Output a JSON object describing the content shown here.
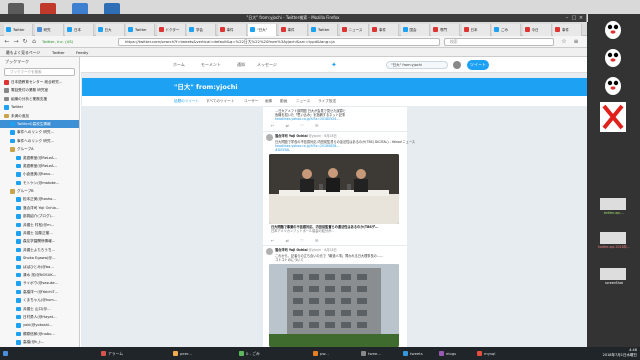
{
  "browser": {
    "window_title": "\"日大\" from:yjochi - Twitter検索 - Mozilla Firefox",
    "url": "https://twitter.com/search?f=tweets&vertical=default&q=%22日大%22%20from%3Ayjochi&src=typd&lang=ja",
    "url_site_label": "Twitter, Inc. (US)",
    "search_placeholder": "検索",
    "tabs": [
      {
        "label": "Twitter",
        "fav_color": "#1da1f2"
      },
      {
        "label": "研究",
        "fav_color": "#4a90d9"
      },
      {
        "label": "日本",
        "fav_color": "#1da1f2"
      },
      {
        "label": "日大",
        "fav_color": "#1da1f2"
      },
      {
        "label": "Twitter",
        "fav_color": "#1da1f2"
      },
      {
        "label": "ドクター",
        "fav_color": "#d33"
      },
      {
        "label": "学会",
        "fav_color": "#1da1f2"
      },
      {
        "label": "事件",
        "fav_color": "#d33"
      },
      {
        "label": "\"日大\"",
        "fav_color": "#1da1f2"
      },
      {
        "label": "事件",
        "fav_color": "#d33"
      },
      {
        "label": "Twitter",
        "fav_color": "#1da1f2"
      },
      {
        "label": "ニュース",
        "fav_color": "#d33"
      },
      {
        "label": "事件",
        "fav_color": "#d33"
      },
      {
        "label": "国会",
        "fav_color": "#1da1f2"
      },
      {
        "label": "専門",
        "fav_color": "#d33"
      },
      {
        "label": "日本",
        "fav_color": "#d33"
      },
      {
        "label": "ごみ",
        "fav_color": "#1da1f2"
      },
      {
        "label": "今日",
        "fav_color": "#d33"
      },
      {
        "label": "事件",
        "fav_color": "#d33"
      }
    ]
  },
  "bookmarks_toolbar": [
    "最もよく見るページ",
    "Twitter",
    "Feedly"
  ],
  "sidebar": {
    "title": "ブックマーク",
    "search_placeholder": "ブックマークを検索",
    "items": [
      {
        "label": "日本語教育センター 総合研究…",
        "color": "#d33",
        "indent": 0
      },
      {
        "label": "電話受付の業務 研究室",
        "color": "#888",
        "indent": 0
      },
      {
        "label": "組織の分析と業務支援",
        "color": "#888",
        "indent": 0
      },
      {
        "label": "Twitter",
        "color": "#1da1f2",
        "indent": 0
      },
      {
        "label": "未満の追加",
        "color": "#caa44a",
        "indent": 0
      },
      {
        "label": "Twitterの高校生情報",
        "color": "#1da1f2",
        "indent": 1,
        "selected": true
      },
      {
        "label": "事件へのリンク 研究…",
        "color": "#1da1f2",
        "indent": 1
      },
      {
        "label": "事件へのリンク 研究…",
        "color": "#1da1f2",
        "indent": 1
      },
      {
        "label": "グループA",
        "color": "#caa44a",
        "indent": 1
      },
      {
        "label": "英語教室(@ReLeA…",
        "color": "#1da1f2",
        "indent": 2
      },
      {
        "label": "英語教室(@ReLeA…",
        "color": "#1da1f2",
        "indent": 2
      },
      {
        "label": "小倉進実(@tosu…",
        "color": "#1da1f2",
        "indent": 2
      },
      {
        "label": "モトケン(@motoke…",
        "color": "#1da1f2",
        "indent": 2
      },
      {
        "label": "グループB",
        "color": "#caa44a",
        "indent": 1
      },
      {
        "label": "松本正美(@tosho…",
        "color": "#1da1f2",
        "indent": 2
      },
      {
        "label": "落合洋司 Yoji Ochia…",
        "color": "#1da1f2",
        "indent": 2
      },
      {
        "label": "部員紹介(ブログ)…",
        "color": "#1da1f2",
        "indent": 2
      },
      {
        "label": "弁護士 村松(@m…",
        "color": "#1da1f2",
        "indent": 2
      },
      {
        "label": "弁護士 加藤正樹…",
        "color": "#1da1f2",
        "indent": 2
      },
      {
        "label": "森友学園関係情報…",
        "color": "#1da1f2",
        "indent": 2
      },
      {
        "label": "弁護士よたろうち…",
        "color": "#1da1f2",
        "indent": 2
      },
      {
        "label": "Shoko Egawa(@…",
        "color": "#1da1f2",
        "indent": 2
      },
      {
        "label": "ばばひとみ(@ba…",
        "color": "#1da1f2",
        "indent": 2
      },
      {
        "label": "清水 潔(@NOSUK…",
        "color": "#1da1f2",
        "indent": 2
      },
      {
        "label": "サイボウ(@sasuke…",
        "color": "#1da1f2",
        "indent": 2
      },
      {
        "label": "高橋洋一(@YoichiT…",
        "color": "#1da1f2",
        "indent": 2
      },
      {
        "label": "くまちゃん(@kum…",
        "color": "#1da1f2",
        "indent": 2
      },
      {
        "label": "弁護士 山口(@…",
        "color": "#1da1f2",
        "indent": 2
      },
      {
        "label": "日村勇人(@Hayat…",
        "color": "#1da1f2",
        "indent": 2
      },
      {
        "label": "yoki(@yokoshi…",
        "color": "#1da1f2",
        "indent": 2
      },
      {
        "label": "郷原信郎(@nobu…",
        "color": "#1da1f2",
        "indent": 2
      },
      {
        "label": "高橋(@h_t…",
        "color": "#1da1f2",
        "indent": 2
      },
      {
        "label": "日弁連(ベテ(…",
        "color": "#1da1f2",
        "indent": 2
      },
      {
        "label": "東 宏正(@hir…",
        "color": "#1da1f2",
        "indent": 2
      },
      {
        "label": "Afrocity(@afroc…",
        "color": "#1da1f2",
        "indent": 2
      }
    ]
  },
  "twitter": {
    "nav": [
      "ホーム",
      "モーメント",
      "通知",
      "メッセージ"
    ],
    "search_value": "\"日大\" from:yjochi",
    "tweet_button": "ツイート",
    "banner_title": "\"日大\" from:yjochi",
    "tabs": [
      "話題のツイート",
      "すべてのツイート",
      "ユーザー",
      "画像",
      "動画",
      "ニュース",
      "ライブ放送"
    ],
    "tweets": [
      {
        "name": "",
        "lines": [
          "…日大アメフト部問題 日大が会見で見せた誤算と",
          "危機を招いた「思い込み」を指摘するネット記事",
          "headlines.yahoo.co.jp/hl?a=20180524-…"
        ]
      },
      {
        "name": "落合洋司 Yoji Ochiai",
        "handle": "@yjochi · 6月28日",
        "lines": [
          "日大問題で学長の不信感対応 内田前監督らの違法性はあるのか(TBS) DIGITAL) - Yahoo!ニュース",
          "headlines.yahoo.co.jp/hl?a=20180628-…",
          "#DIGITAL"
        ],
        "card_title": "日大問題で事業の不信感対応、内田前監督らの違法性はあるのか(TBSデ…",
        "card_desc": "日本アメリカンフットボール協会の処分が…"
      },
      {
        "name": "落合洋司 Yoji Ochiai",
        "handle": "@yjochi · 6月28日",
        "lines": [
          "これから、記者らの立ち合いの元で「報道人事」問われる日大理事長の……",
          "コトコトのについて"
        ]
      }
    ],
    "card_caption": "「日大の財政」の中核、内田前監督らの適法…"
  },
  "desktop": {
    "labels": [
      "twitter-api-...",
      "twitter-api-2018年...",
      "screenShot"
    ]
  },
  "taskbar": {
    "items": [
      "",
      "アラーム",
      "peer...",
      "0 - ごみ",
      "pw...",
      "twee...",
      "tweets",
      "elogs",
      "mysql"
    ],
    "clock_time": "4:48",
    "clock_date": "2018年7月1日水曜日"
  }
}
